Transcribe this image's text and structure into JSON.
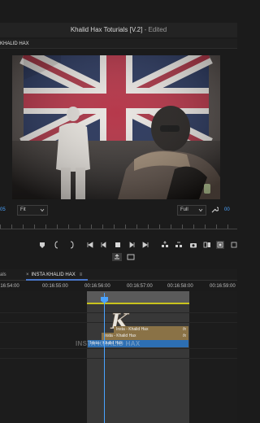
{
  "window": {
    "title": "Khalid Hax Toturials [V.2]",
    "status": "- Edited"
  },
  "monitor": {
    "tab_label": "KHALID HAX"
  },
  "controls": {
    "timecode_left": "05",
    "fit_label": "Fit",
    "full_label": "Full",
    "timecode_right": "00"
  },
  "timeline": {
    "prev_tab": "als",
    "active_tab": "INSTA KHALID HAX",
    "close_symbol": "×",
    "menu_symbol": "≡",
    "timecodes": [
      "00:16:54:00",
      "00:16:55:00",
      "00:16:56:00",
      "00:16:57:00",
      "00:16:58:00",
      "00:16:59:00"
    ],
    "clips": [
      {
        "label": "Insta - Khalid Hax",
        "fx": "fx"
      },
      {
        "label": "Insta - Khalid Hax",
        "fx": "fx"
      },
      {
        "label": "Insta - Khalid Hax",
        "fx": ""
      }
    ],
    "watermark": "INSTA KHALID HAX"
  },
  "colors": {
    "accent": "#4aa3ff",
    "clip_brown": "#8a7246",
    "clip_blue": "#2d6fb3",
    "work_bar": "#c9c31e"
  }
}
